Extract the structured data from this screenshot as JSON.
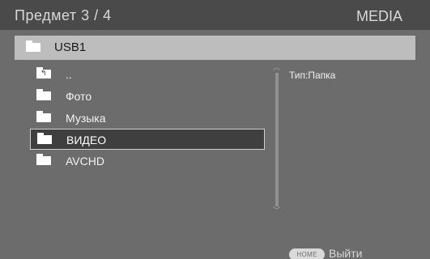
{
  "header": {
    "item_counter": "Предмет 3 / 4",
    "title": "MEDIA"
  },
  "path_bar": {
    "icon": "folder-icon",
    "label": "USB1"
  },
  "file_list": {
    "items": [
      {
        "label": "..",
        "icon": "folder-up-icon",
        "selected": false
      },
      {
        "label": "Фото",
        "icon": "folder-icon",
        "selected": false
      },
      {
        "label": "Музыка",
        "icon": "folder-icon",
        "selected": false
      },
      {
        "label": "ВИДЕО",
        "icon": "folder-icon",
        "selected": true
      },
      {
        "label": "AVCHD",
        "icon": "folder-icon",
        "selected": false
      }
    ]
  },
  "info_panel": {
    "type_text": "Тип:Папка"
  },
  "scrollbar": {
    "up_icon": "chevron-up-icon",
    "down_icon": "chevron-down-icon"
  },
  "footer": {
    "home_button_label": "HOME",
    "exit_label": "Выйти"
  },
  "colors": {
    "background": "#6c6c6c",
    "header": "#4a4a4a",
    "path_bar": "#bdbdbd",
    "selection": "#3f3f3f"
  }
}
